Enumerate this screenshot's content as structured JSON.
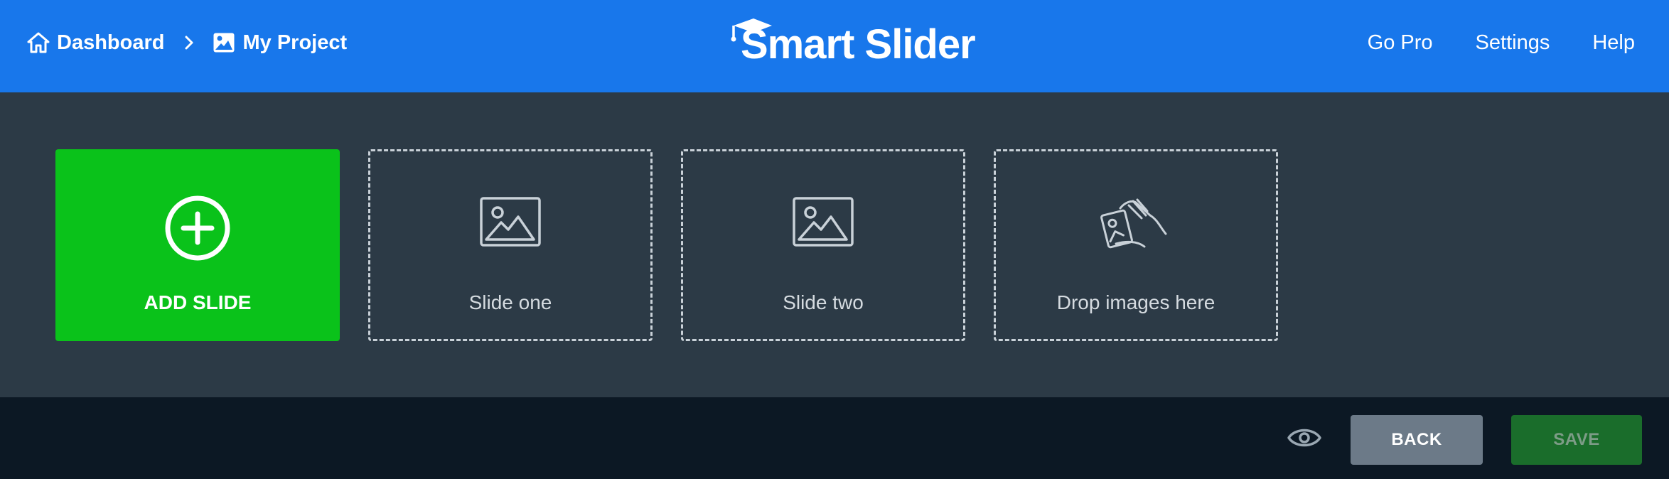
{
  "header": {
    "breadcrumb": [
      {
        "label": "Dashboard",
        "icon": "home-icon"
      },
      {
        "label": "My Project",
        "icon": "image-icon"
      }
    ],
    "logo_text": "Smart Slider",
    "nav": [
      "Go Pro",
      "Settings",
      "Help"
    ],
    "color": "#1877eb"
  },
  "slides": {
    "add_label": "ADD SLIDE",
    "items": [
      {
        "label": "Slide one",
        "icon": "image-icon"
      },
      {
        "label": "Slide two",
        "icon": "image-icon"
      }
    ],
    "drop_label": "Drop images here",
    "add_color": "#0ac21a"
  },
  "footer": {
    "back_label": "BACK",
    "save_label": "SAVE",
    "preview_icon": "eye-icon"
  }
}
